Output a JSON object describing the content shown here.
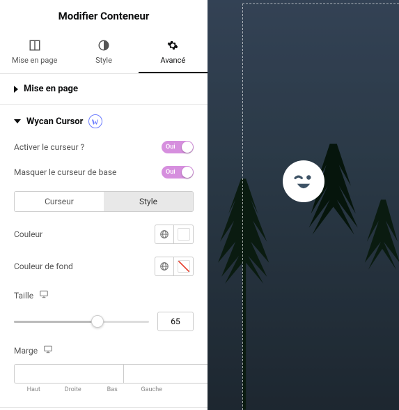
{
  "title": "Modifier Conteneur",
  "tabs": [
    {
      "label": "Mise en page"
    },
    {
      "label": "Style"
    },
    {
      "label": "Avancé"
    }
  ],
  "sections": {
    "layout": {
      "title": "Mise en page"
    },
    "cursor": {
      "title": "Wycan Cursor",
      "activate": {
        "label": "Activer le curseur ?",
        "toggle": "Oui"
      },
      "hide_base": {
        "label": "Masquer le curseur de base",
        "toggle": "Oui"
      },
      "seg": {
        "cursor": "Curseur",
        "style": "Style"
      },
      "color": {
        "label": "Couleur"
      },
      "bg_color": {
        "label": "Couleur de fond"
      },
      "size": {
        "label": "Taille",
        "value": "65"
      },
      "margin": {
        "label": "Marge",
        "sides": {
          "top": "Haut",
          "right": "Droite",
          "bottom": "Bas",
          "left": "Gauche"
        }
      }
    }
  }
}
